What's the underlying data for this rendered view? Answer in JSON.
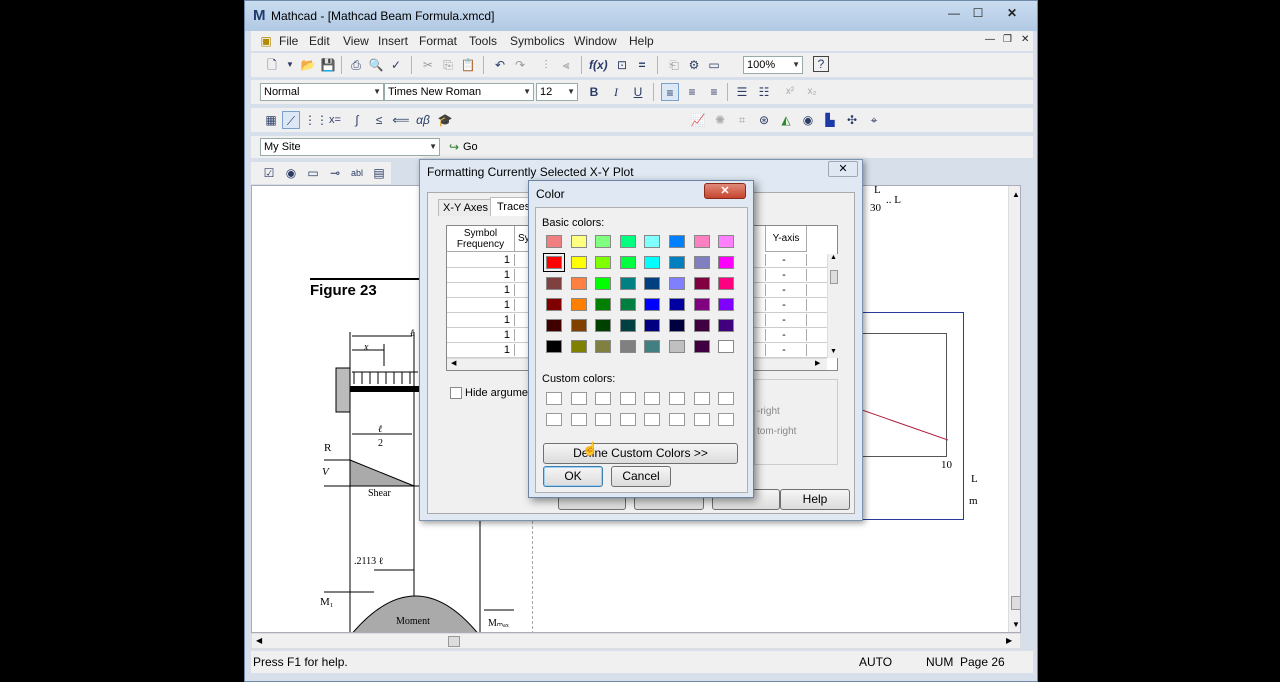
{
  "window": {
    "title": "Mathcad - [Mathcad Beam Formula.xmcd]",
    "logo": "M",
    "min": "—",
    "max": "☐",
    "close": "✕"
  },
  "menu": [
    "File",
    "Edit",
    "View",
    "Insert",
    "Format",
    "Tools",
    "Symbolics",
    "Window",
    "Help"
  ],
  "toolbar": {
    "zoom": "100%",
    "style": "Normal",
    "font": "Times New Roman",
    "size": "12",
    "bold": "B",
    "italic": "I",
    "underline": "U",
    "site": "My Site",
    "go": "Go"
  },
  "format_dialog": {
    "title": "Formatting Currently Selected X-Y Plot",
    "tabs": [
      "X-Y Axes",
      "Traces"
    ],
    "col_symbol_freq": "Symbol Frequency",
    "col_sy": "Sy",
    "col_yaxis": "Y-axis",
    "freq_values": [
      "1",
      "1",
      "1",
      "1",
      "1",
      "1",
      "1"
    ],
    "yaxis_values": [
      "-",
      "-",
      "-",
      "-",
      "-",
      "-",
      "-"
    ],
    "hide_arguments": "Hide argument",
    "legend_top_right": "-right",
    "legend_bottom_right": "tom-right",
    "help": "Help"
  },
  "color_dialog": {
    "title": "Color",
    "basic_label": "Basic colors:",
    "custom_label": "Custom colors:",
    "define_custom": "Define Custom Colors >>",
    "ok": "OK",
    "cancel": "Cancel",
    "basic_colors": [
      [
        "#f08080",
        "#ffff80",
        "#80ff80",
        "#00ff80",
        "#80ffff",
        "#0080ff",
        "#ff80c0",
        "#ff80ff"
      ],
      [
        "#ff0000",
        "#ffff00",
        "#80ff00",
        "#00ff40",
        "#00ffff",
        "#0080c0",
        "#8080c0",
        "#ff00ff"
      ],
      [
        "#804040",
        "#ff8040",
        "#00ff00",
        "#008080",
        "#004080",
        "#8080ff",
        "#800040",
        "#ff0080"
      ],
      [
        "#800000",
        "#ff8000",
        "#008000",
        "#008040",
        "#0000ff",
        "#0000a0",
        "#800080",
        "#8000ff"
      ],
      [
        "#400000",
        "#804000",
        "#004000",
        "#004040",
        "#000080",
        "#000040",
        "#400040",
        "#400080"
      ],
      [
        "#000000",
        "#808000",
        "#808040",
        "#808080",
        "#408080",
        "#c0c0c0",
        "#400040",
        "#ffffff"
      ]
    ],
    "selected": "#ff0000"
  },
  "document": {
    "figure_label": "Figure 23",
    "shear": "Shear",
    "moment": "Moment",
    "v": "V",
    "r": "R",
    "x": "x",
    "l": "ℓ",
    "l_over_2_num": "ℓ",
    "l_over_2_den": "2",
    "dim_2113": ".2113 ℓ",
    "m1": "M₁",
    "mmax": "Mₘₐₓ",
    "eq_frac_num": "L",
    "eq_frac_den": "30",
    "eq_tail": ".. L",
    "plot_tick": "10",
    "plot_label_num": "L",
    "plot_label_den": "m"
  },
  "status": {
    "help": "Press F1 for help.",
    "auto": "AUTO",
    "num": "NUM",
    "page": "Page 26"
  }
}
